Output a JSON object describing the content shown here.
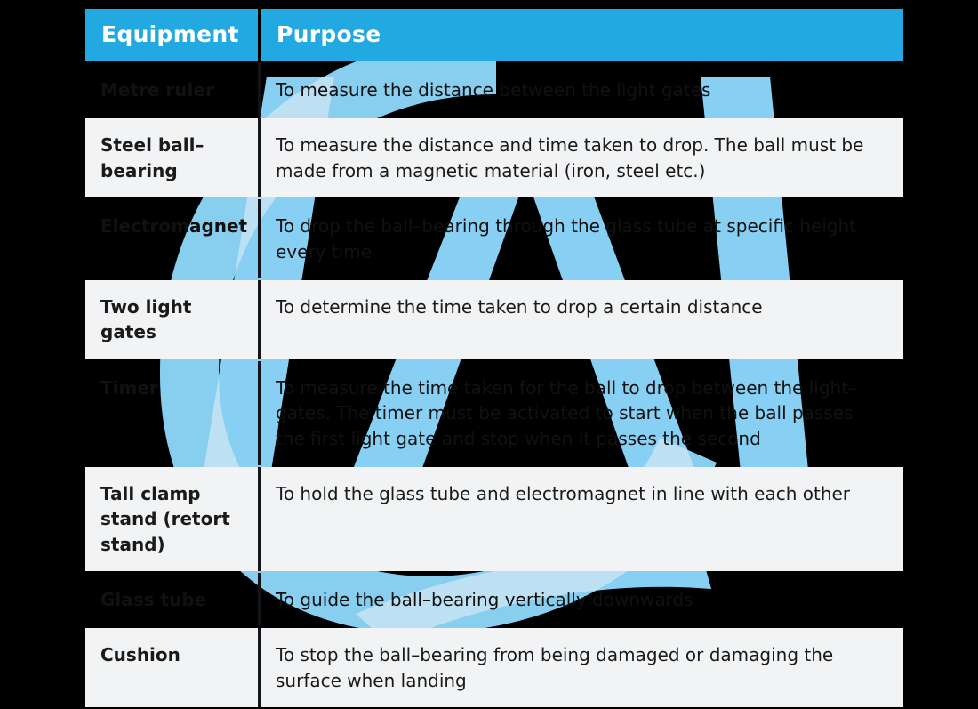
{
  "page": {
    "background_color": "#000000",
    "accent_color": "#23A9E1",
    "watermark_blue": "#12AEF5",
    "watermark_light": "#E9EDF0",
    "light_row_color": "#F2F3F4",
    "header_text_color": "#FFFFFF"
  },
  "table": {
    "headers": {
      "equipment": "Equipment",
      "purpose": "Purpose"
    },
    "rows": [
      {
        "equipment": "Metre ruler",
        "purpose": "To measure the distance between the light gates",
        "style": "dark"
      },
      {
        "equipment": "Steel ball–bearing",
        "purpose": "To measure the distance and time taken to drop. The ball must be made from a magnetic material (iron, steel etc.)",
        "style": "light"
      },
      {
        "equipment": "Electromagnet",
        "purpose": "To drop the ball–bearing through the glass tube at specific height every time",
        "style": "dark"
      },
      {
        "equipment": "Two light gates",
        "purpose": "To determine the time taken to drop a certain distance",
        "style": "light"
      },
      {
        "equipment": "Timer",
        "purpose": "To measure the time taken for the ball to drop between the light–gates. The timer must be activated to start when the ball passes the first light gate and stop when it passes the second",
        "style": "dark"
      },
      {
        "equipment": "Tall clamp stand (retort stand)",
        "purpose": "To hold the glass tube and electromagnet in line with each other",
        "style": "light"
      },
      {
        "equipment": "Glass tube",
        "purpose": "To guide the ball–bearing vertically downwards",
        "style": "dark"
      },
      {
        "equipment": "Cushion",
        "purpose": "To stop the ball–bearing from being damaged or damaging the surface when landing",
        "style": "light"
      }
    ]
  }
}
